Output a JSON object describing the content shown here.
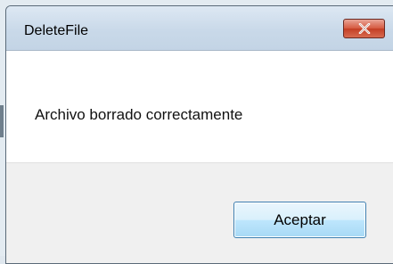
{
  "window": {
    "title": "DeleteFile",
    "close_icon": "close-icon"
  },
  "dialog": {
    "message": "Archivo borrado correctamente",
    "ok_label": "Aceptar"
  },
  "colors": {
    "close_button": "#d5583f",
    "ok_button": "#bee6fd",
    "ok_border": "#3c7fb1"
  }
}
